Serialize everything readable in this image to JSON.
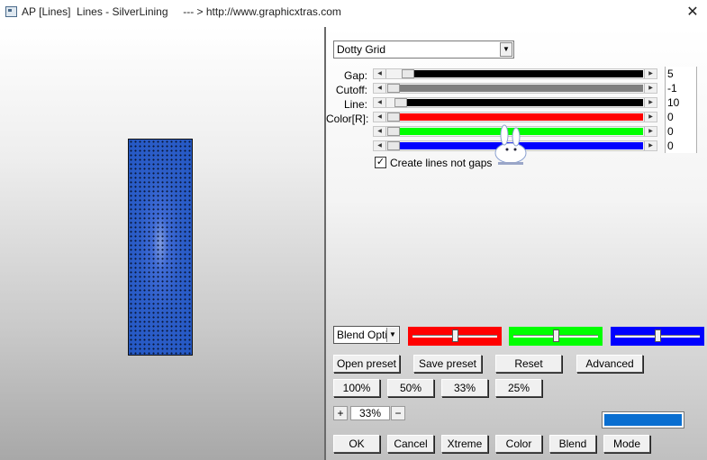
{
  "window": {
    "title": "AP [Lines]  Lines - SilverLining     --- > http://www.graphicxtras.com",
    "close_glyph": "✕"
  },
  "preset_select": {
    "value": "Dotty Grid"
  },
  "sliders": [
    {
      "label": "Gap:",
      "value": "5",
      "track_color": "#000000",
      "level": 0.06
    },
    {
      "label": "Cutoff:",
      "value": "-1",
      "track_color": "#808080",
      "level": 0.0
    },
    {
      "label": "Line:",
      "value": "10",
      "track_color": "#000000",
      "level": 0.03
    },
    {
      "label": "Color[R]:",
      "value": "0",
      "track_color": "#ff0000",
      "level": 0.0
    },
    {
      "label": "",
      "value": "0",
      "track_color": "#00ff00",
      "level": 0.0
    },
    {
      "label": "",
      "value": "0",
      "track_color": "#0000ff",
      "level": 0.0
    }
  ],
  "option": {
    "label": "Create lines not gaps",
    "checked": true
  },
  "blend": {
    "select_value": "Blend Optio",
    "channels": [
      {
        "color": "#ff0000",
        "level": 0.5
      },
      {
        "color": "#00ff00",
        "level": 0.5
      },
      {
        "color": "#0000ff",
        "level": 0.5
      }
    ]
  },
  "buttons": {
    "open_preset": "Open preset",
    "save_preset": "Save preset",
    "reset": "Reset",
    "advanced": "Advanced",
    "z100": "100%",
    "z50": "50%",
    "z33": "33%",
    "z25": "25%",
    "ok": "OK",
    "cancel": "Cancel",
    "xtreme": "Xtreme",
    "color": "Color",
    "blend": "Blend",
    "mode": "Mode"
  },
  "zoom": {
    "plus": "+",
    "value": "33%",
    "minus": "−"
  },
  "current_color": "#0a6fd1"
}
